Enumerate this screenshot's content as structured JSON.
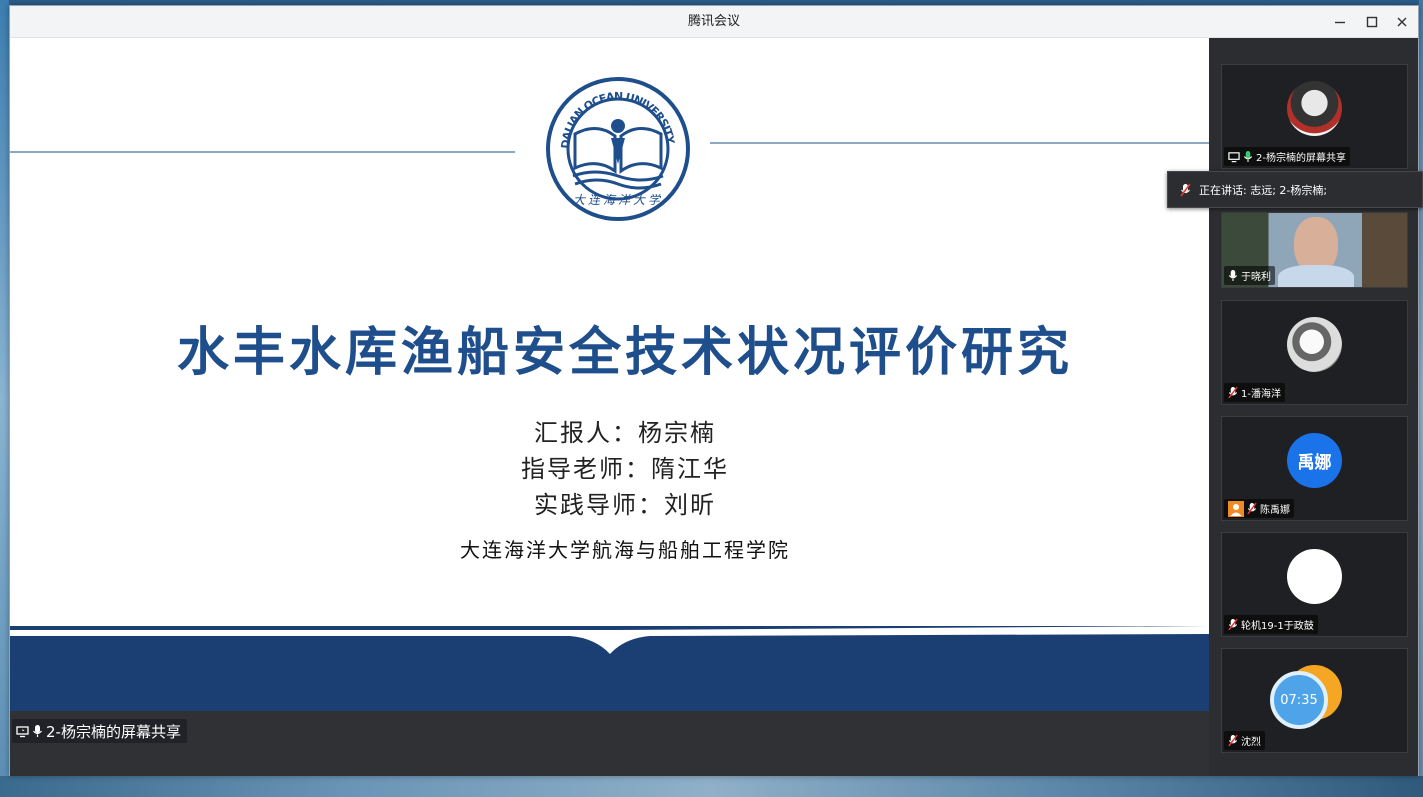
{
  "window": {
    "title": "腾讯会议"
  },
  "slide": {
    "title": "水丰水库渔船安全技术状况评价研究",
    "presenter_line": "汇报人：杨宗楠",
    "advisor_line": "指导老师：隋江华",
    "practice_line": "实践导师：刘昕",
    "school": "大连海洋大学航海与船舶工程学院",
    "logo_text": "DALIAN OCEAN UNIVERSITY",
    "logo_cn": "大连海洋大学"
  },
  "share": {
    "label": "2-杨宗楠的屏幕共享"
  },
  "speaking": {
    "text": "正在讲话: 志远; 2-杨宗楠;"
  },
  "participants": [
    {
      "name": "2-杨宗楠的屏幕共享",
      "avatar": "photo"
    },
    {
      "name": "于晓利",
      "avatar": "video"
    },
    {
      "name": "1-潘海洋",
      "avatar": "photo"
    },
    {
      "name": "陈禹娜",
      "avatar": "text",
      "avatar_text": "禹娜",
      "avatar_color": "#1a73e8"
    },
    {
      "name": "轮机19-1于政鼓",
      "avatar": "blank"
    },
    {
      "name": "沈烈",
      "avatar": "clock",
      "avatar_text": "07:35"
    }
  ],
  "colors": {
    "slide_title": "#1f4e8c",
    "slide_band": "#1b3f73"
  }
}
